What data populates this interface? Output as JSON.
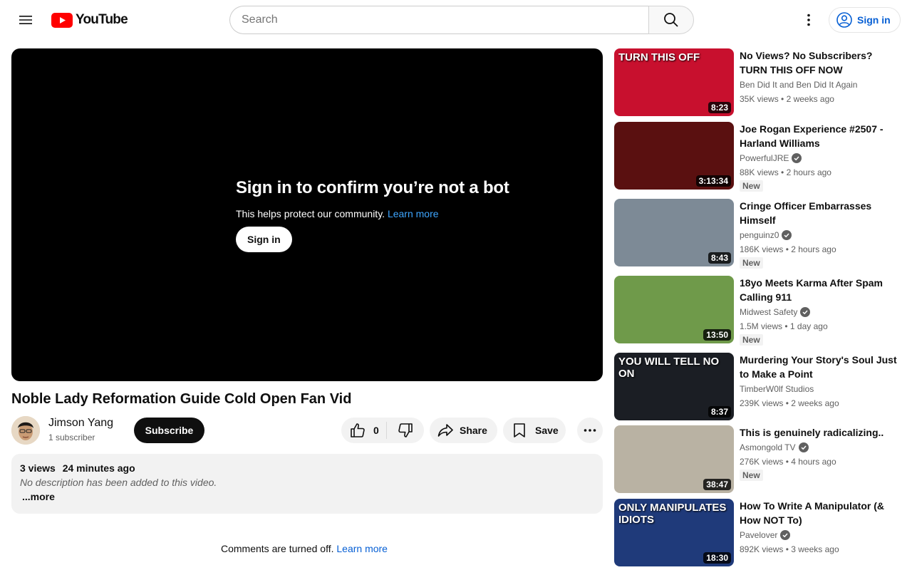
{
  "header": {
    "logo_text": "YouTube",
    "search_placeholder": "Search",
    "signin_label": "Sign in"
  },
  "player": {
    "bot_title": "Sign in to confirm you’re not a bot",
    "bot_subtitle": "This helps protect our community.",
    "bot_learn_more": "Learn more",
    "bot_signin": "Sign in"
  },
  "video": {
    "title": "Noble Lady Reformation Guide Cold Open Fan Vid",
    "channel": "Jimson Yang",
    "subscribers": "1 subscriber",
    "subscribe_label": "Subscribe",
    "likes": "0",
    "share_label": "Share",
    "save_label": "Save",
    "views": "3 views",
    "posted": "24 minutes ago",
    "description": "No description has been added to this video.",
    "more_label": "...more"
  },
  "comments": {
    "text": "Comments are turned off.",
    "learn_more": "Learn more"
  },
  "recommendations": [
    {
      "title": "No Views? No Subscribers? TURN THIS OFF NOW",
      "channel": "Ben Did It and Ben Did It Again",
      "verified": false,
      "views": "35K views",
      "age": "2 weeks ago",
      "duration": "8:23",
      "badge": "",
      "thumb_text": "TURN THIS OFF",
      "thumb_bg": "#c8102e"
    },
    {
      "title": "Joe Rogan Experience #2507 - Harland Williams",
      "channel": "PowerfulJRE",
      "verified": true,
      "views": "88K views",
      "age": "2 hours ago",
      "duration": "3:13:34",
      "badge": "New",
      "thumb_text": "",
      "thumb_bg": "#5a1010"
    },
    {
      "title": "Cringe Officer Embarrasses Himself",
      "channel": "penguinz0",
      "verified": true,
      "views": "186K views",
      "age": "2 hours ago",
      "duration": "8:43",
      "badge": "New",
      "thumb_text": "",
      "thumb_bg": "#7d8a96"
    },
    {
      "title": "18yo Meets Karma After Spam Calling 911",
      "channel": "Midwest Safety",
      "verified": true,
      "views": "1.5M views",
      "age": "1 day ago",
      "duration": "13:50",
      "badge": "New",
      "thumb_text": "",
      "thumb_bg": "#6f9a4a"
    },
    {
      "title": "Murdering Your Story's Soul Just to Make a Point",
      "channel": "TimberW0lf Studios",
      "verified": false,
      "views": "239K views",
      "age": "2 weeks ago",
      "duration": "8:37",
      "badge": "",
      "thumb_text": "YOU WILL TELL NO ON",
      "thumb_bg": "#1b1e24"
    },
    {
      "title": "This is genuinely radicalizing..",
      "channel": "Asmongold TV",
      "verified": true,
      "views": "276K views",
      "age": "4 hours ago",
      "duration": "38:47",
      "badge": "New",
      "thumb_text": "",
      "thumb_bg": "#b9b2a3"
    },
    {
      "title": "How To Write A Manipulator (& How NOT To)",
      "channel": "Pavelover",
      "verified": true,
      "views": "892K views",
      "age": "3 weeks ago",
      "duration": "18:30",
      "badge": "",
      "thumb_text": "ONLY MANIPULATES IDIOTS",
      "thumb_bg": "#1f3a7a"
    }
  ]
}
